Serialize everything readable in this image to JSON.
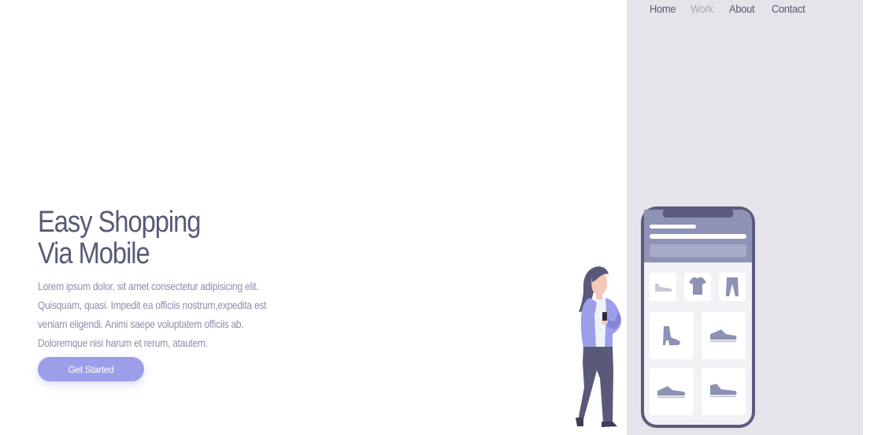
{
  "nav": {
    "items": [
      {
        "label": "Home",
        "active": false
      },
      {
        "label": "Work",
        "active": true
      },
      {
        "label": "About",
        "active": false
      },
      {
        "label": "Contact",
        "active": false
      }
    ]
  },
  "hero": {
    "title_line1": "Easy Shopping",
    "title_line2": "Via Mobile",
    "description": "Lorem ipsum dolor, sit amet consectetur adipisicing elit. Quisquam, quasi. Impedit ea officiis nostrum,expedita est veniam eligendi. Animi saepe voluptatem officiis ab. Doloremque nisi harum et rerum, atautem.",
    "cta_label": "Get Started"
  },
  "illustration": {
    "phone_items": [
      "shoe-icon",
      "tshirt-icon",
      "pants-icon",
      "boot-icon",
      "sneaker-icon",
      "sneaker-icon",
      "sneaker-icon"
    ],
    "colors": {
      "phone_frame": "#5b5b7e",
      "phone_screen_header": "#8e92b5",
      "item_icon": "#8d91b4",
      "person_jacket": "#9d9ee9",
      "person_pants": "#585a78",
      "panel_background": "#e5e4ea",
      "accent": "#9d9ee9"
    }
  }
}
